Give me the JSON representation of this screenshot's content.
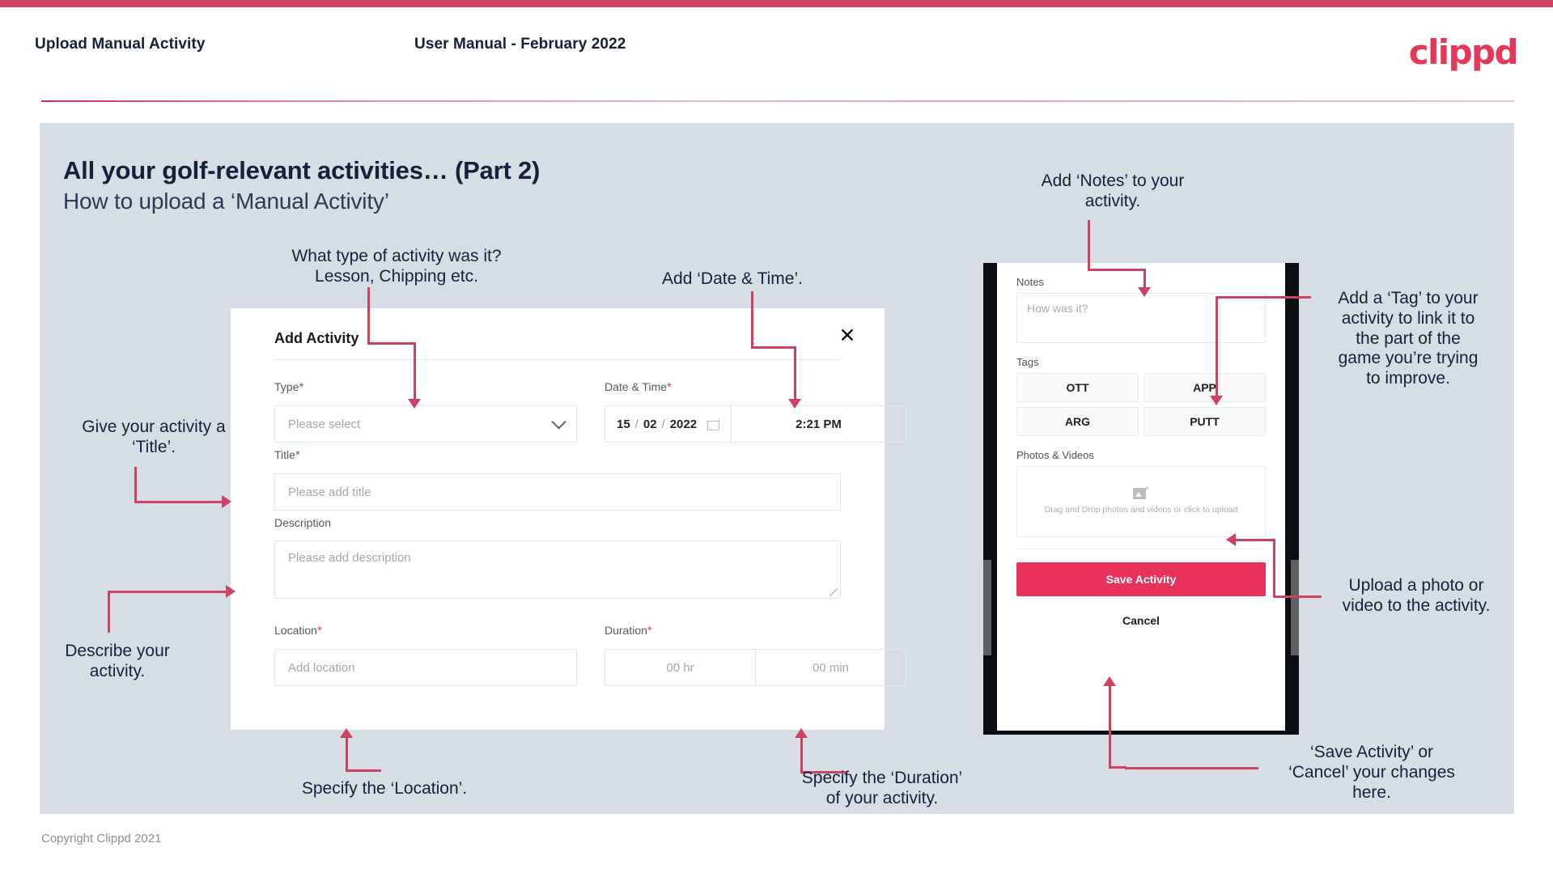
{
  "header": {
    "title": "Upload Manual Activity",
    "subtitle": "User Manual - February 2022",
    "logo": "clippd",
    "accent_color": "#cf4161"
  },
  "slide": {
    "title": "All your golf-relevant activities… (Part 2)",
    "subtitle": "How to upload a ‘Manual Activity’",
    "background_color": "#d7dde5"
  },
  "modal": {
    "title": "Add Activity",
    "close_icon": "close-icon",
    "fields": {
      "type": {
        "label": "Type",
        "required": "*",
        "placeholder": "Please select"
      },
      "datetime": {
        "label": "Date & Time",
        "required": "*",
        "day": "15",
        "sep1": "/",
        "month": "02",
        "sep2": "/",
        "year": "2022",
        "time": "2:21 PM"
      },
      "title": {
        "label": "Title",
        "required": "*",
        "placeholder": "Please add title"
      },
      "description": {
        "label": "Description",
        "required": "",
        "placeholder": "Please add description"
      },
      "location": {
        "label": "Location",
        "required": "*",
        "placeholder": "Add location"
      },
      "duration": {
        "label": "Duration",
        "required": "*",
        "hours": "00 hr",
        "minutes": "00 min"
      }
    }
  },
  "phone": {
    "notes": {
      "label": "Notes",
      "placeholder": "How was it?"
    },
    "tags": {
      "label": "Tags",
      "items": [
        "OTT",
        "APP",
        "ARG",
        "PUTT"
      ]
    },
    "photos": {
      "label": "Photos & Videos",
      "dropzone_text": "Drag and Drop photos and videos or click to upload",
      "icon": "image-add-icon"
    },
    "save_label": "Save Activity",
    "cancel_label": "Cancel",
    "save_color": "#e8325c"
  },
  "annotations": {
    "type": "What type of activity was it?\nLesson, Chipping etc.",
    "datetime": "Add ‘Date & Time’.",
    "title": "Give your activity a\n‘Title’.",
    "description": "Describe your\nactivity.",
    "location": "Specify the ‘Location’.",
    "duration": "Specify the ‘Duration’\nof your activity.",
    "notes": "Add ‘Notes’ to your\nactivity.",
    "tags": "Add a ‘Tag’ to your\nactivity to link it to\nthe part of the\ngame you’re trying\nto improve.",
    "photos": "Upload a photo or\nvideo to the activity.",
    "save": "‘Save Activity’ or\n‘Cancel’ your changes\nhere."
  },
  "footer": {
    "copyright": "Copyright Clippd 2021"
  }
}
